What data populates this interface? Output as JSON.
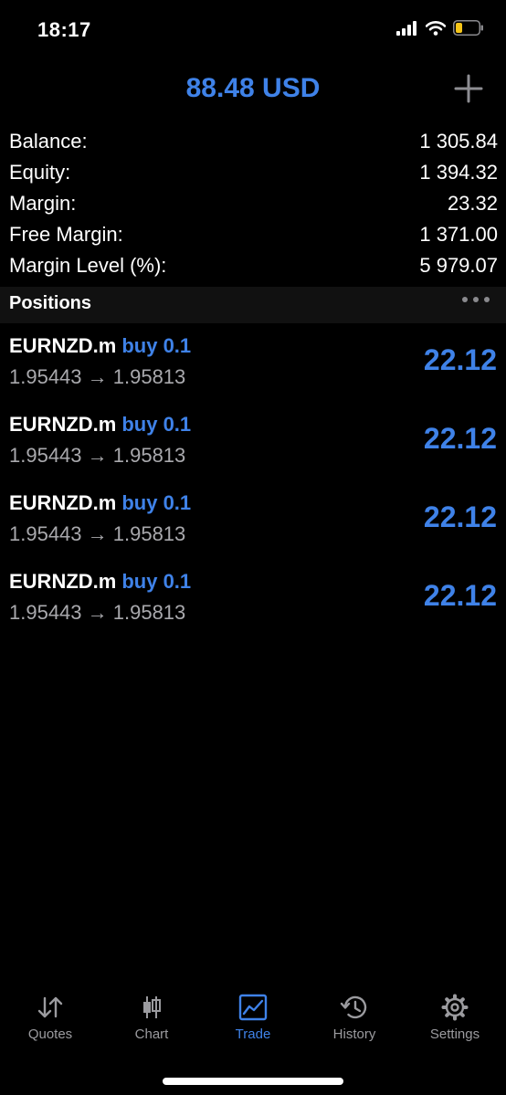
{
  "status": {
    "time": "18:17"
  },
  "header": {
    "title": "88.48 USD"
  },
  "summary": [
    {
      "label": "Balance:",
      "value": "1 305.84"
    },
    {
      "label": "Equity:",
      "value": "1 394.32"
    },
    {
      "label": "Margin:",
      "value": "23.32"
    },
    {
      "label": "Free Margin:",
      "value": "1 371.00"
    },
    {
      "label": "Margin Level (%):",
      "value": "5 979.07"
    }
  ],
  "positions_section": {
    "title": "Positions"
  },
  "positions": [
    {
      "symbol": "EURNZD.m",
      "side": "buy 0.1",
      "prices": "1.95443 → 1.95813",
      "profit": "22.12"
    },
    {
      "symbol": "EURNZD.m",
      "side": "buy 0.1",
      "prices": "1.95443 → 1.95813",
      "profit": "22.12"
    },
    {
      "symbol": "EURNZD.m",
      "side": "buy 0.1",
      "prices": "1.95443 → 1.95813",
      "profit": "22.12"
    },
    {
      "symbol": "EURNZD.m",
      "side": "buy 0.1",
      "prices": "1.95443 → 1.95813",
      "profit": "22.12"
    }
  ],
  "tabs": [
    {
      "label": "Quotes",
      "icon": "sort-arrows-icon"
    },
    {
      "label": "Chart",
      "icon": "candlestick-icon"
    },
    {
      "label": "Trade",
      "icon": "trade-chart-icon",
      "active": true
    },
    {
      "label": "History",
      "icon": "history-clock-icon"
    },
    {
      "label": "Settings",
      "icon": "gear-icon"
    }
  ],
  "colors": {
    "accent": "#3f82e8",
    "background": "#000000",
    "secondary_text": "#a9a9ad",
    "section_bg": "#111111"
  }
}
